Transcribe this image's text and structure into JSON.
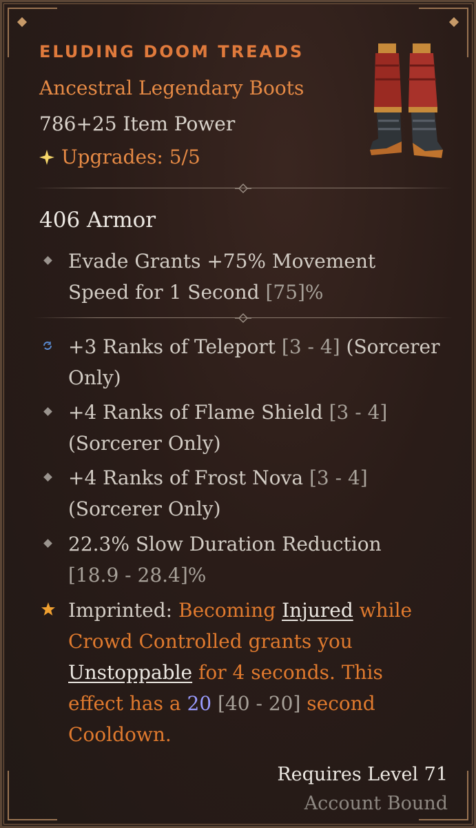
{
  "item": {
    "name": "ELUDING DOOM TREADS",
    "type": "Ancestral Legendary Boots",
    "power": "786+25 Item Power",
    "upgrades": "Upgrades: 5/5",
    "armor": "406 Armor"
  },
  "implicit": {
    "line1": "Evade Grants +75% Movement",
    "line2_text": "Speed for 1 Second ",
    "line2_range": "[75]%"
  },
  "affixes": [
    {
      "icon": "cycle-icon",
      "line1_text": "+3 Ranks of Teleport ",
      "line1_range": "[3 - 4]",
      "line1_tail": " (Sorcerer",
      "line2": "Only)"
    },
    {
      "icon": "diamond-bullet-icon",
      "line1_text": "+4 Ranks of Flame Shield ",
      "line1_range": "[3 - 4]",
      "line2": "(Sorcerer Only)"
    },
    {
      "icon": "diamond-bullet-icon",
      "line1_text": "+4 Ranks of Frost Nova ",
      "line1_range": "[3 - 4]",
      "line2": "(Sorcerer Only)"
    },
    {
      "icon": "diamond-bullet-icon",
      "line1_text": "22.3% Slow Duration Reduction",
      "line2_range": "[18.9 - 28.4]",
      "line2_tail": "%"
    }
  ],
  "imprint": {
    "label": "Imprinted: ",
    "t1": "Becoming ",
    "kw1": "Injured",
    "t2": " while",
    "line2": "Crowd Controlled grants you",
    "kw2": "Unstoppable",
    "t3": " for 4 seconds. This",
    "t4": "effect has a ",
    "value": "20",
    "range": " [40 - 20]",
    "t5": " second",
    "line5": "Cooldown."
  },
  "footer": {
    "requires": "Requires Level 71",
    "bound": "Account Bound"
  },
  "colors": {
    "legendary": "#e07a3c",
    "value_highlight": "#9a9cff",
    "upgrade_spark": "#f5d66a"
  }
}
